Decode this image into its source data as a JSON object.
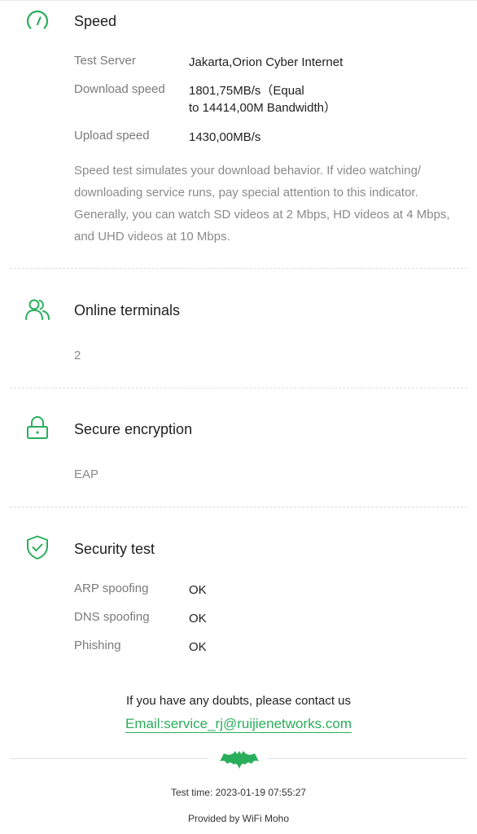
{
  "colors": {
    "accent": "#2aae5b"
  },
  "speed": {
    "title": "Speed",
    "icon": "speedometer-icon",
    "rows": [
      {
        "label": "Test Server",
        "value": "Jakarta,Orion Cyber Internet"
      },
      {
        "label": "Download speed",
        "value_line1": "1801,75MB/s（Equal",
        "value_line2": "to 14414,00M Bandwidth）"
      },
      {
        "label": "Upload speed",
        "value": "1430,00MB/s"
      }
    ],
    "description": "Speed test simulates your download behavior. If video watching/ downloading service runs, pay special attention to this indicator. Generally, you can watch SD videos at 2 Mbps, HD videos at 4 Mbps, and UHD videos at 10 Mbps."
  },
  "terminals": {
    "title": "Online terminals",
    "icon": "users-icon",
    "value": "2"
  },
  "encryption": {
    "title": "Secure encryption",
    "icon": "lock-icon",
    "value": "EAP"
  },
  "security": {
    "title": "Security test",
    "icon": "shield-check-icon",
    "rows": [
      {
        "label": "ARP spoofing",
        "value": "OK"
      },
      {
        "label": "DNS spoofing",
        "value": "OK"
      },
      {
        "label": "Phishing",
        "value": "OK"
      }
    ]
  },
  "contact": {
    "text": "If you have any doubts, please contact us",
    "email": "Email:service_rj@ruijienetworks.com"
  },
  "footer": {
    "logo_icon": "bat-logo-icon",
    "test_time": "Test time: 2023-01-19 07:55:27",
    "provided_by": "Provided by WiFi Moho"
  }
}
